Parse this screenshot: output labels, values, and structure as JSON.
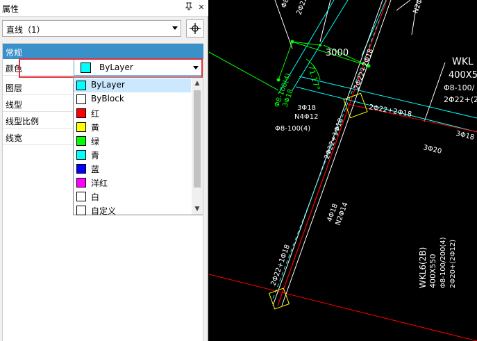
{
  "panel": {
    "title": "属性",
    "pin_icon": "pin-icon",
    "close_icon": "close-icon"
  },
  "selector": {
    "value": "直线（1）",
    "pick_icon": "crosshair-icon"
  },
  "section": {
    "label": "常规"
  },
  "properties": [
    {
      "label": "颜色"
    },
    {
      "label": "图层"
    },
    {
      "label": "线型"
    },
    {
      "label": "线型比例"
    },
    {
      "label": "线宽"
    }
  ],
  "color_field": {
    "value": "ByLayer",
    "swatch": "#00ffff"
  },
  "dropdown": {
    "options": [
      {
        "label": "ByLayer",
        "color": "#00ffff",
        "selected": true
      },
      {
        "label": "ByBlock",
        "color": "#ffffff"
      },
      {
        "label": "红",
        "color": "#ff0000"
      },
      {
        "label": "黄",
        "color": "#ffff00"
      },
      {
        "label": "绿",
        "color": "#00ff00"
      },
      {
        "label": "青",
        "color": "#00ffff"
      },
      {
        "label": "蓝",
        "color": "#0000ff"
      },
      {
        "label": "洋红",
        "color": "#ff00ff"
      },
      {
        "label": "白",
        "color": "#ffffff"
      },
      {
        "label": "自定义",
        "color": "#ffffff"
      }
    ]
  },
  "cad": {
    "labels": {
      "dim_3000": "3000",
      "wkl": "WKL",
      "wkl_size": "400X5",
      "wkl_stir": "Φ8-100/",
      "wkl_rebar": "2Φ22+(2",
      "wkl6": "WKL6(2B)",
      "wkl6_size": "400X550",
      "wkl6_stir": "Φ8-100/200(4)",
      "wkl6_rebar": "2Φ20+(2Φ12)",
      "r1": "2Φ22+2Φ18",
      "r2": "3Φ20",
      "r3": "3Φ18",
      "r4": "N4Φ12",
      "r5": "Φ8-100(4)",
      "r6": "2Φ22+1Φ18",
      "r7": "4Φ18",
      "r8": "N2Φ14",
      "r9": "2Φ22+1Φ18",
      "r10": "Φ8-100(4)",
      "r11": "3Φ18",
      "r12": "2Φ22+2Φ18",
      "r13": "Φ8-",
      "r14": "Φ8-100/",
      "r15": "2Φ22",
      "r16": "3Φ18",
      "r17": "N2Φ14",
      "angle": "71.17°"
    }
  }
}
